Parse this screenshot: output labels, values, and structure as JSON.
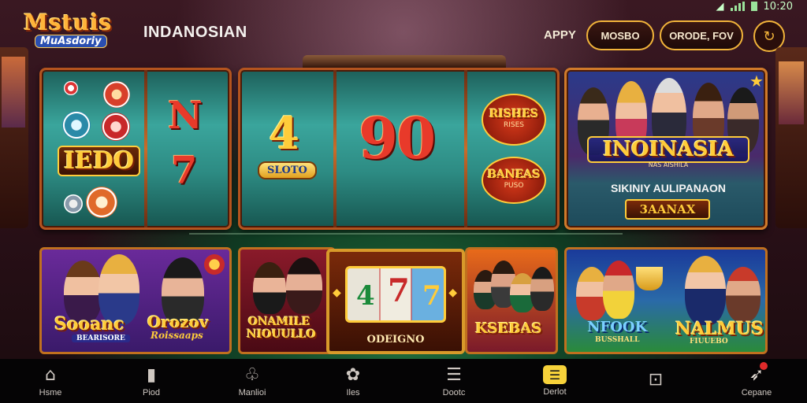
{
  "status": {
    "time": "10:20"
  },
  "header": {
    "logo_line1": "Mstuis",
    "logo_line2": "MuAsdoriy",
    "title": "INDANOSIAN",
    "appy_label": "APPY",
    "button1_label": "MOSBO",
    "button2_label": "ORODE, FOV"
  },
  "panels": {
    "slot_left": {
      "symbol_1": "N",
      "symbol_2": "7",
      "banner": "IEDO"
    },
    "slot_center": {
      "symbol_main": "4",
      "slot_tag": "SLOTO",
      "big_number": "90",
      "badge_top": "RISHES",
      "badge_top_sub": "RISES",
      "badge_bottom": "BANEAS",
      "badge_bottom_sub": "PUSO"
    },
    "promo": {
      "title": "INOINASIA",
      "title_sub": "NAS AISHILA",
      "subtitle": "SIKINIY AULIPANAON",
      "button": "3AANAX"
    }
  },
  "cards": [
    {
      "title": "Sooanc",
      "subtitle": "BEARISORE"
    },
    {
      "title": "Orozov",
      "subtitle": "Roissaaps"
    },
    {
      "title": "ONAMILE",
      "subtitle": "NIOUULLO"
    },
    {
      "title": "ODEIGNO",
      "reel": [
        "4",
        "7",
        "7"
      ]
    },
    {
      "title": "KSEBAS"
    },
    {
      "title": "NFOOK",
      "subtitle": "BUSSHALL"
    },
    {
      "title": "NALMUS",
      "subtitle": "FIUUEBO"
    }
  ],
  "nav": [
    {
      "label": "Hsme",
      "icon": "home-icon"
    },
    {
      "label": "Piod",
      "icon": "card-icon"
    },
    {
      "label": "Manlioi",
      "icon": "club-icon"
    },
    {
      "label": "Iles",
      "icon": "gear-icon"
    },
    {
      "label": "Dootc",
      "icon": "chart-icon"
    },
    {
      "label": "Derlot",
      "icon": "menu-icon",
      "active": true
    },
    {
      "label": "",
      "icon": "user-icon"
    },
    {
      "label": "Cepane",
      "icon": "rocket-icon"
    }
  ],
  "colors": {
    "accent_gold": "#f2b43a",
    "frame": "#b4541f",
    "reel_teal": "#2d8b83",
    "nav_active": "#f7d23a"
  }
}
